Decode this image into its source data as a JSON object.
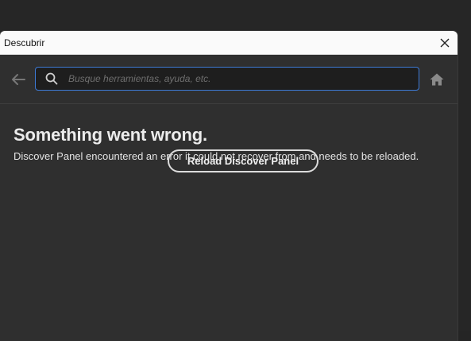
{
  "window": {
    "title": "Descubrir"
  },
  "toolbar": {
    "search_placeholder": "Busque herramientas, ayuda, etc."
  },
  "error": {
    "heading": "Something went wrong.",
    "message": "Discover Panel encountered an error it could not recover from and needs to be reloaded.",
    "reload_label": "Reload Discover Panel"
  },
  "icons": {
    "back": "arrow-left-icon",
    "search": "search-icon",
    "home": "home-icon",
    "close": "close-icon"
  },
  "colors": {
    "accent": "#3d7ad6",
    "panel_bg": "#2f2f2f",
    "titlebar_bg": "#fafafa"
  }
}
